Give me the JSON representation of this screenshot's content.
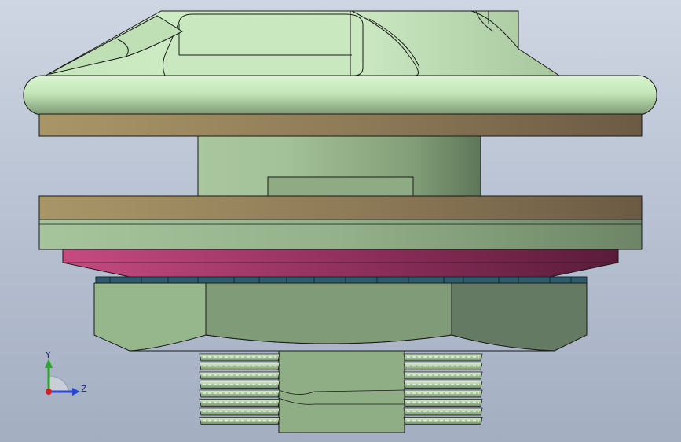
{
  "viewport": {
    "background_top": "#cfd6e3",
    "background_bottom": "#a3aec1"
  },
  "model": {
    "colors": {
      "green_light": "#cfeec7",
      "green_mid": "#a8c89c",
      "green_dark": "#6f8a68",
      "tan_light": "#b4a274",
      "tan_dark": "#6f5f45",
      "magenta_light": "#c24a7e",
      "magenta_dark": "#5a1c3a",
      "washer_blue": "#2e5a6a",
      "edge": "#1a1a1a"
    }
  },
  "triad": {
    "y_label": "Y",
    "z_label": "Z",
    "y_color": "#2fa52f",
    "z_color": "#2a46d8",
    "x_color": "#d42020"
  }
}
